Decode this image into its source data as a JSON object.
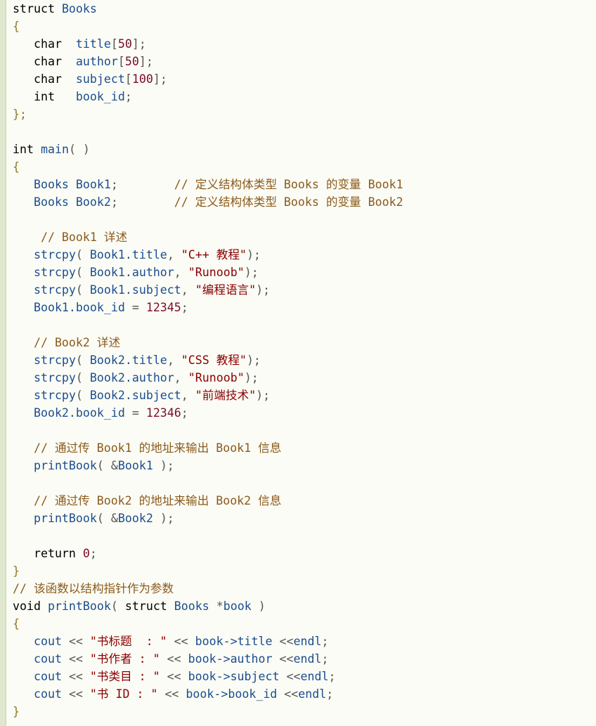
{
  "lines": [
    [
      [
        "kw",
        "struct "
      ],
      [
        "id",
        "Books"
      ]
    ],
    [
      [
        "brace",
        "{"
      ]
    ],
    [
      [
        "kw",
        "   char  "
      ],
      [
        "id",
        "title"
      ],
      [
        "pun",
        "["
      ],
      [
        "num",
        "50"
      ],
      [
        "pun",
        "];"
      ]
    ],
    [
      [
        "kw",
        "   char  "
      ],
      [
        "id",
        "author"
      ],
      [
        "pun",
        "["
      ],
      [
        "num",
        "50"
      ],
      [
        "pun",
        "];"
      ]
    ],
    [
      [
        "kw",
        "   char  "
      ],
      [
        "id",
        "subject"
      ],
      [
        "pun",
        "["
      ],
      [
        "num",
        "100"
      ],
      [
        "pun",
        "];"
      ]
    ],
    [
      [
        "kw",
        "   int   "
      ],
      [
        "id",
        "book_id"
      ],
      [
        "pun",
        ";"
      ]
    ],
    [
      [
        "brace",
        "};"
      ]
    ],
    [],
    [
      [
        "kw",
        "int "
      ],
      [
        "id",
        "main"
      ],
      [
        "pun",
        "( )"
      ]
    ],
    [
      [
        "brace",
        "{"
      ]
    ],
    [
      [
        "id",
        "   Books Book1"
      ],
      [
        "pun",
        ";        "
      ],
      [
        "cm",
        "// 定义结构体类型 Books 的变量 Book1"
      ]
    ],
    [
      [
        "id",
        "   Books Book2"
      ],
      [
        "pun",
        ";        "
      ],
      [
        "cm",
        "// 定义结构体类型 Books 的变量 Book2"
      ]
    ],
    [],
    [
      [
        "cm",
        "    // Book1 详述"
      ]
    ],
    [
      [
        "id",
        "   strcpy"
      ],
      [
        "pun",
        "( "
      ],
      [
        "id",
        "Book1.title"
      ],
      [
        "pun",
        ", "
      ],
      [
        "str",
        "\"C++ 教程\""
      ],
      [
        "pun",
        ");"
      ]
    ],
    [
      [
        "id",
        "   strcpy"
      ],
      [
        "pun",
        "( "
      ],
      [
        "id",
        "Book1.author"
      ],
      [
        "pun",
        ", "
      ],
      [
        "str",
        "\"Runoob\""
      ],
      [
        "pun",
        ");"
      ]
    ],
    [
      [
        "id",
        "   strcpy"
      ],
      [
        "pun",
        "( "
      ],
      [
        "id",
        "Book1.subject"
      ],
      [
        "pun",
        ", "
      ],
      [
        "str",
        "\"编程语言\""
      ],
      [
        "pun",
        ");"
      ]
    ],
    [
      [
        "id",
        "   Book1.book_id "
      ],
      [
        "pun",
        "= "
      ],
      [
        "num",
        "12345"
      ],
      [
        "pun",
        ";"
      ]
    ],
    [],
    [
      [
        "cm",
        "   // Book2 详述"
      ]
    ],
    [
      [
        "id",
        "   strcpy"
      ],
      [
        "pun",
        "( "
      ],
      [
        "id",
        "Book2.title"
      ],
      [
        "pun",
        ", "
      ],
      [
        "str",
        "\"CSS 教程\""
      ],
      [
        "pun",
        ");"
      ]
    ],
    [
      [
        "id",
        "   strcpy"
      ],
      [
        "pun",
        "( "
      ],
      [
        "id",
        "Book2.author"
      ],
      [
        "pun",
        ", "
      ],
      [
        "str",
        "\"Runoob\""
      ],
      [
        "pun",
        ");"
      ]
    ],
    [
      [
        "id",
        "   strcpy"
      ],
      [
        "pun",
        "( "
      ],
      [
        "id",
        "Book2.subject"
      ],
      [
        "pun",
        ", "
      ],
      [
        "str",
        "\"前端技术\""
      ],
      [
        "pun",
        ");"
      ]
    ],
    [
      [
        "id",
        "   Book2.book_id "
      ],
      [
        "pun",
        "= "
      ],
      [
        "num",
        "12346"
      ],
      [
        "pun",
        ";"
      ]
    ],
    [],
    [
      [
        "cm",
        "   // 通过传 Book1 的地址来输出 Book1 信息"
      ]
    ],
    [
      [
        "id",
        "   printBook"
      ],
      [
        "pun",
        "( &"
      ],
      [
        "id",
        "Book1"
      ],
      [
        "pun",
        " );"
      ]
    ],
    [],
    [
      [
        "cm",
        "   // 通过传 Book2 的地址来输出 Book2 信息"
      ]
    ],
    [
      [
        "id",
        "   printBook"
      ],
      [
        "pun",
        "( &"
      ],
      [
        "id",
        "Book2"
      ],
      [
        "pun",
        " );"
      ]
    ],
    [],
    [
      [
        "ret",
        "   return "
      ],
      [
        "num",
        "0"
      ],
      [
        "pun",
        ";"
      ]
    ],
    [
      [
        "brace",
        "}"
      ]
    ],
    [
      [
        "cm",
        "// 该函数以结构指针作为参数"
      ]
    ],
    [
      [
        "kw",
        "void "
      ],
      [
        "id",
        "printBook"
      ],
      [
        "pun",
        "( "
      ],
      [
        "kw",
        "struct "
      ],
      [
        "id",
        "Books"
      ],
      [
        "pun",
        " *"
      ],
      [
        "id",
        "book"
      ],
      [
        "pun",
        " )"
      ]
    ],
    [
      [
        "brace",
        "{"
      ]
    ],
    [
      [
        "id",
        "   cout "
      ],
      [
        "pun",
        "<< "
      ],
      [
        "str",
        "\"书标题  : \""
      ],
      [
        "pun",
        " << "
      ],
      [
        "id",
        "book->title"
      ],
      [
        "pun",
        " <<"
      ],
      [
        "id",
        "endl"
      ],
      [
        "pun",
        ";"
      ]
    ],
    [
      [
        "id",
        "   cout "
      ],
      [
        "pun",
        "<< "
      ],
      [
        "str",
        "\"书作者 : \""
      ],
      [
        "pun",
        " << "
      ],
      [
        "id",
        "book->author"
      ],
      [
        "pun",
        " <<"
      ],
      [
        "id",
        "endl"
      ],
      [
        "pun",
        ";"
      ]
    ],
    [
      [
        "id",
        "   cout "
      ],
      [
        "pun",
        "<< "
      ],
      [
        "str",
        "\"书类目 : \""
      ],
      [
        "pun",
        " << "
      ],
      [
        "id",
        "book->subject"
      ],
      [
        "pun",
        " <<"
      ],
      [
        "id",
        "endl"
      ],
      [
        "pun",
        ";"
      ]
    ],
    [
      [
        "id",
        "   cout "
      ],
      [
        "pun",
        "<< "
      ],
      [
        "str",
        "\"书 ID : \""
      ],
      [
        "pun",
        " << "
      ],
      [
        "id",
        "book->book_id"
      ],
      [
        "pun",
        " <<"
      ],
      [
        "id",
        "endl"
      ],
      [
        "pun",
        ";"
      ]
    ],
    [
      [
        "brace",
        "}"
      ]
    ]
  ]
}
